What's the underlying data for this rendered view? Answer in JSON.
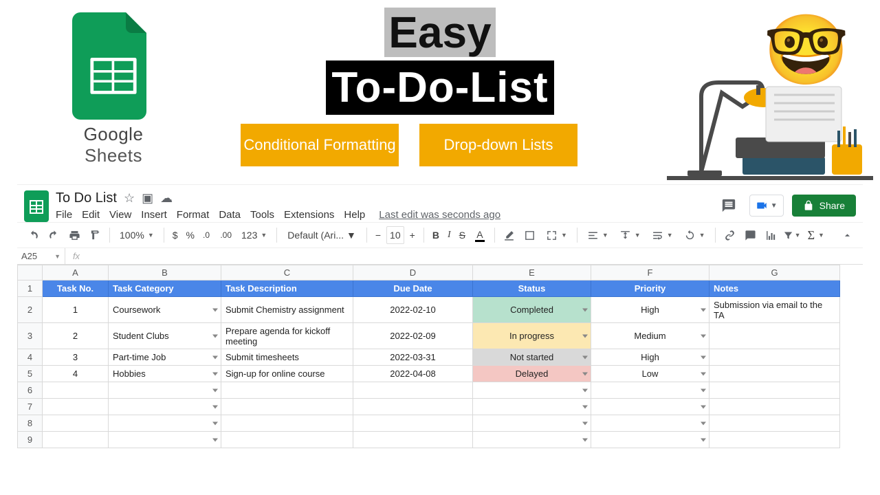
{
  "hero": {
    "title_easy": "Easy",
    "title_list": "To-Do-List",
    "pill1": "Conditional Formatting",
    "pill2": "Drop-down Lists",
    "brand_text": "Google Sheets"
  },
  "doc": {
    "title": "To Do List",
    "last_edit": "Last edit was seconds ago",
    "share": "Share"
  },
  "menus": [
    "File",
    "Edit",
    "View",
    "Insert",
    "Format",
    "Data",
    "Tools",
    "Extensions",
    "Help"
  ],
  "toolbar": {
    "zoom": "100%",
    "font": "Default (Ari...",
    "size": "10",
    "fmt": "123"
  },
  "name_box": "A25",
  "columns": [
    "A",
    "B",
    "C",
    "D",
    "E",
    "F",
    "G"
  ],
  "headers": {
    "a": "Task No.",
    "b": "Task Category",
    "c": "Task Description",
    "d": "Due Date",
    "e": "Status",
    "f": "Priority",
    "g": "Notes"
  },
  "rows": [
    {
      "n": "1",
      "num": "1",
      "cat": "Coursework",
      "desc": "Submit Chemistry assignment",
      "due": "2022-02-10",
      "status": "Completed",
      "status_cls": "status-completed",
      "prio": "High",
      "notes": "Submission via email to the TA",
      "tall": true
    },
    {
      "n": "2",
      "num": "2",
      "cat": "Student Clubs",
      "desc": "Prepare agenda for kickoff meeting",
      "due": "2022-02-09",
      "status": "In progress",
      "status_cls": "status-inprogress",
      "prio": "Medium",
      "notes": "",
      "tall": true
    },
    {
      "n": "3",
      "num": "3",
      "cat": "Part-time Job",
      "desc": "Submit timesheets",
      "due": "2022-03-31",
      "status": "Not started",
      "status_cls": "status-notstarted",
      "prio": "High",
      "notes": "",
      "tall": false
    },
    {
      "n": "4",
      "num": "4",
      "cat": "Hobbies",
      "desc": "Sign-up for online course",
      "due": "2022-04-08",
      "status": "Delayed",
      "status_cls": "status-delayed",
      "prio": "Low",
      "notes": "",
      "tall": false
    }
  ],
  "empty_rows": [
    "6",
    "7",
    "8",
    "9"
  ]
}
